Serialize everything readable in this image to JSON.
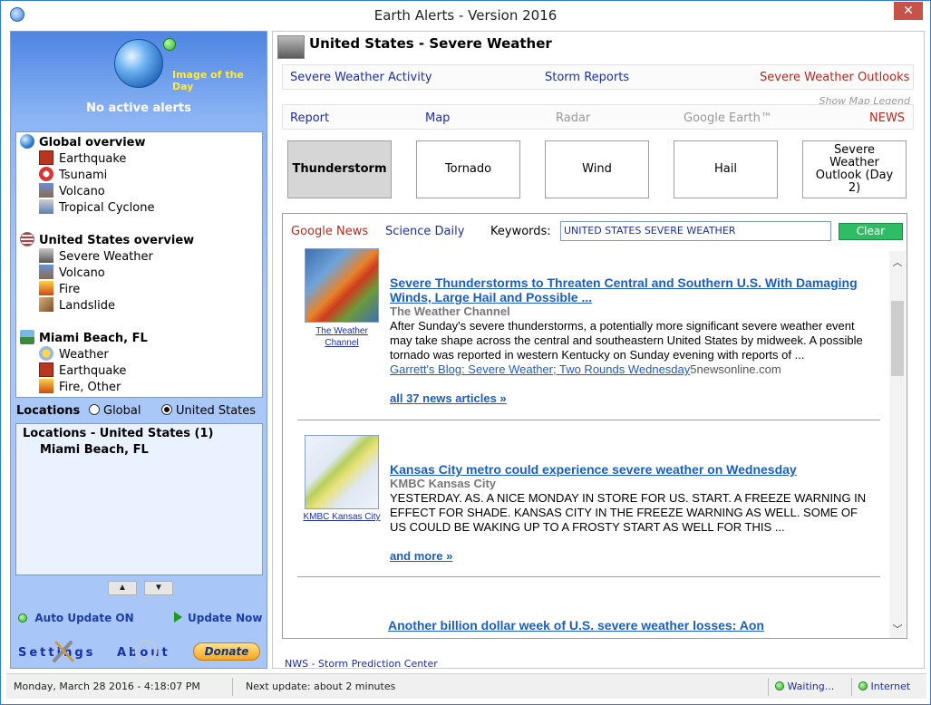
{
  "window": {
    "title": "Earth Alerts - Version 2016",
    "close_label": "✕"
  },
  "left": {
    "image_of_day": "Image of the Day",
    "no_alerts": "No active alerts",
    "tree": {
      "groups": [
        {
          "label": "Global overview",
          "items": [
            "Earthquake",
            "Tsunami",
            "Volcano",
            "Tropical Cyclone"
          ]
        },
        {
          "label": "United States overview",
          "items": [
            "Severe Weather",
            "Volcano",
            "Fire",
            "Landslide"
          ]
        },
        {
          "label": "Miami Beach, FL",
          "items": [
            "Weather",
            "Earthquake",
            "Fire, Other"
          ]
        }
      ]
    },
    "locations": {
      "label": "Locations",
      "opt_global": "Global",
      "opt_us": "United States",
      "selected": "United States",
      "header": "Locations - United States (1)",
      "city": "Miami Beach, FL"
    },
    "auto_update": "Auto Update ON",
    "update_now": "Update Now",
    "settings": "Settings",
    "about": "About",
    "donate": "Donate"
  },
  "right": {
    "title": "United States - Severe Weather",
    "row1": {
      "activity": "Severe Weather Activity",
      "storm_reports": "Storm Reports",
      "outlooks": "Severe Weather Outlooks"
    },
    "show_legend": "Show Map Legend",
    "row2": {
      "report": "Report",
      "map": "Map",
      "radar": "Radar",
      "google_earth": "Google Earth™",
      "news": "NEWS"
    },
    "types": {
      "thunderstorm": "Thunderstorm",
      "tornado": "Tornado",
      "wind": "Wind",
      "hail": "Hail",
      "outlook": "Severe Weather Outlook (Day 2)"
    },
    "news": {
      "google_news": "Google News",
      "science_daily": "Science Daily",
      "keywords_label": "Keywords:",
      "keywords_value": "UNITED STATES SEVERE WEATHER",
      "clear": "Clear",
      "articles": [
        {
          "thumb_caption": "The Weather Channel",
          "title": "Severe Thunderstorms to Threaten Central and Southern U.S. With Damaging Winds, Large Hail and Possible ...",
          "source": "The Weather Channel",
          "body": "After Sunday's severe thunderstorms, a potentially more significant severe weather event may take shape across the central and southeastern United States by midweek. A possible tornado was reported in western Kentucky on Sunday evening with reports of ...",
          "blog_link": "Garrett's Blog: Severe Weather; Two Rounds Wednesday",
          "blog_source": "5newsonline.com",
          "more": "all 37 news articles »"
        },
        {
          "thumb_caption": "KMBC Kansas City",
          "title": "Kansas City metro could experience severe weather on Wednesday",
          "source": "KMBC Kansas City",
          "body": "YESTERDAY. AS. A NICE MONDAY IN STORE FOR US. START. A FREEZE WARNING IN EFFECT FOR SHADE. KANSAS CITY IN THE FREEZE WARNING AS WELL. SOME OF US COULD BE WAKING UP TO A FROSTY START AS WELL FOR THIS ...",
          "more": "and more »"
        },
        {
          "title": "Another billion dollar week of U.S. severe weather losses: Aon"
        }
      ]
    },
    "footer_link": "NWS - Storm Prediction Center"
  },
  "status": {
    "datetime": "Monday, March 28 2016 - 4:18:07 PM",
    "next_update": "Next update: about 2 minutes",
    "waiting": "Waiting...",
    "internet": "Internet"
  },
  "colors": {
    "accent_blue": "#1c2fa8",
    "link_blue": "#1a5fbf",
    "clear_green": "#2ebd64",
    "outlook_red": "#b12b20"
  }
}
